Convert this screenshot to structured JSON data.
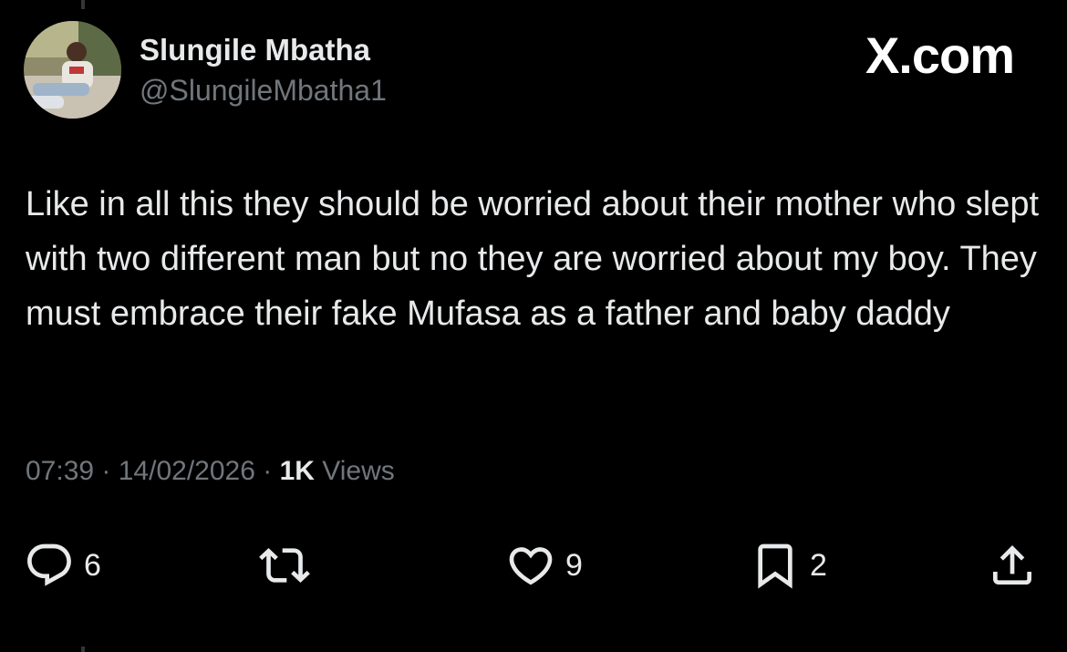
{
  "author": {
    "display_name": "Slungile Mbatha",
    "handle": "@SlungileMbatha1"
  },
  "brand": {
    "logo_text": "X.com"
  },
  "tweet": {
    "text": "Like in all this they should be worried about their mother who slept with two different man but no they are worried about my boy. They must embrace their fake Mufasa as a father and baby daddy",
    "time": "07:39",
    "date": "14/02/2026",
    "separator": " · ",
    "views_count": "1K",
    "views_label": " Views"
  },
  "actions": {
    "reply_count": "6",
    "repost_count": "",
    "like_count": "9",
    "bookmark_count": "2"
  },
  "icons": {
    "reply": "reply-icon",
    "repost": "repost-icon",
    "like": "like-icon",
    "bookmark": "bookmark-icon",
    "share": "share-icon"
  },
  "colors": {
    "background": "#000000",
    "primary_text": "#e7e9ea",
    "secondary_text": "#71767b"
  }
}
